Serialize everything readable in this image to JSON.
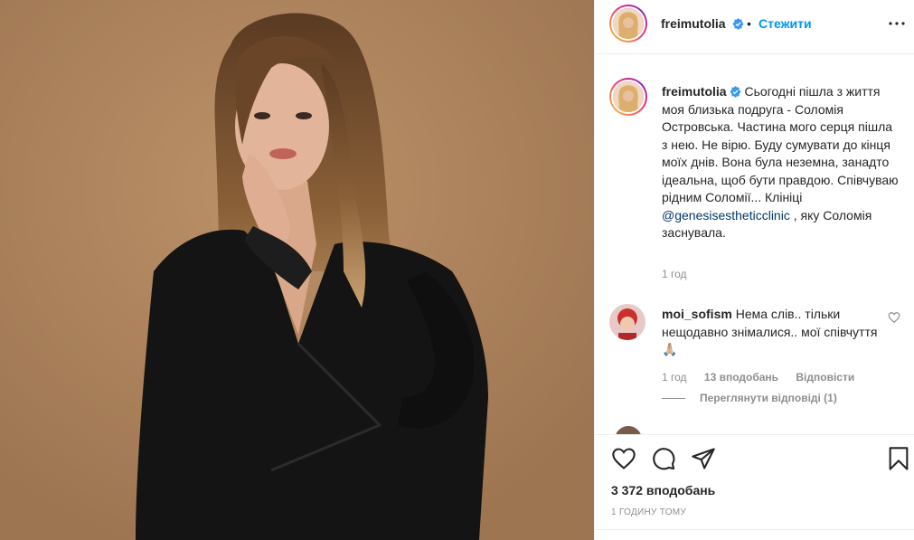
{
  "post": {
    "author": "freimutolia",
    "dot": "•",
    "follow_label": "Стежити",
    "caption_text": "Сьогодні пішла з життя моя близька подруга - Соломія Островська. Частина мого серця пішла з нею. Не вірю. Буду сумувати до кінця моїх днів. Вона була неземна, занадто ідеальна, щоб бути правдою. Співчуваю рідним Соломії... Клініці ",
    "caption_mention": "@genesisestheticclinic",
    "caption_tail": " , яку Соломія заснувала.",
    "caption_time": "1 год",
    "likes": "3 372 вподобань",
    "time": "1 годину тому"
  },
  "comment": {
    "author": "moi_sofism",
    "text": "Нема слів.. тільки нещодавно знімалися.. мої співчуття🙏🏼",
    "time": "1 год",
    "likes": "13 вподобань",
    "reply_label": "Відповісти",
    "view_replies": "Переглянути відповіді (1)"
  },
  "colors": {
    "accent": "#0095f6",
    "verified": "#3897f0",
    "muted": "#8e8e8e",
    "mention": "#00376b"
  },
  "icons": [
    "more-icon",
    "verified-icon",
    "heart-icon",
    "comment-icon",
    "share-icon",
    "bookmark-icon"
  ]
}
